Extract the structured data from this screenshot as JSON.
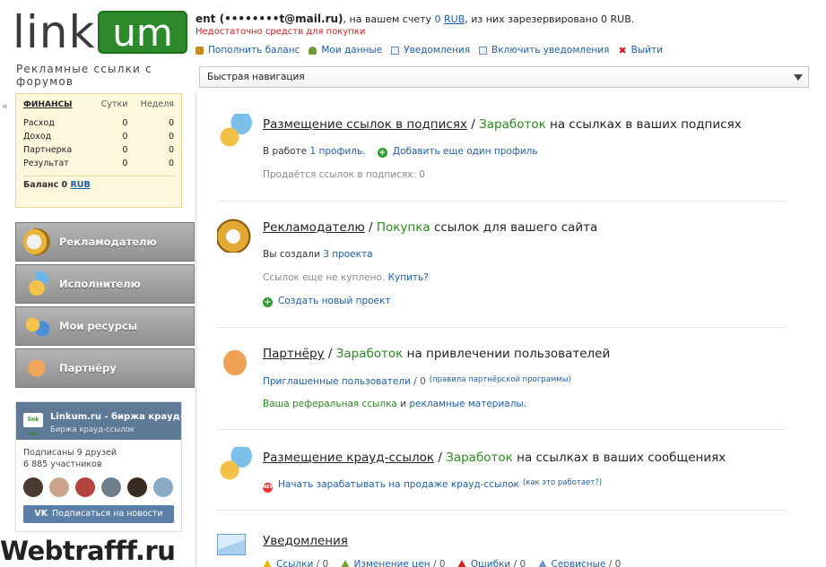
{
  "logo": {
    "word1": "link",
    "word2": "um",
    "tagline": "Рекламные ссылки с форумов"
  },
  "header": {
    "email": "ent (••••••••t@mail.ru)",
    "balance_prefix": ", на вашем счету ",
    "balance_amount": "0",
    "balance_currency": "RUB",
    "reserved_text": ", из них зарезервировано 0 RUB.",
    "insufficient": "Недостаточно средств для покупки",
    "menu": [
      {
        "label": "Пополнить баланс",
        "icon": "wallet-icon"
      },
      {
        "label": "Мои данные",
        "icon": "user-icon"
      },
      {
        "label": "Уведомления",
        "icon": "mail-icon"
      },
      {
        "label": "Включить уведомления",
        "icon": "mail-icon"
      },
      {
        "label": "Выйти",
        "icon": "close-icon"
      }
    ]
  },
  "quicknav": {
    "label": "Быстрая навигация"
  },
  "sidebar": {
    "collapse": "«",
    "finance": {
      "headers": [
        "ФИНАНСЫ",
        "Сутки",
        "Неделя"
      ],
      "rows": [
        [
          "Расход",
          "0",
          "0"
        ],
        [
          "Доход",
          "0",
          "0"
        ],
        [
          "Партнерка",
          "0",
          "0"
        ],
        [
          "Результат",
          "0",
          "0"
        ]
      ],
      "balance_label": "Баланс 0",
      "balance_currency": "RUB"
    },
    "buttons": [
      {
        "label": "Рекламодателю",
        "icon": "megaphone-icon"
      },
      {
        "label": "Исполнителю",
        "icon": "chat-person-icon"
      },
      {
        "label": "Мои ресурсы",
        "icon": "people-icon"
      },
      {
        "label": "Партнёру",
        "icon": "handshake-icon"
      }
    ],
    "vk": {
      "logo_text": "link um",
      "group_name": "Linkum.ru - биржа крауд-сс...",
      "group_sub": "Биржа крауд-ссылок",
      "friends": "Подписаны 9 друзей",
      "members": "6 885 участников",
      "subscribe": "Подписаться на новости"
    }
  },
  "watermark": "Webtrafff.ru",
  "sections": {
    "signatures": {
      "title_link": "Размещение ссылок в подписях",
      "sep": " / ",
      "title_green": "Заработок",
      "title_rest": " на ссылках в ваших подписях",
      "line1_prefix": "В работе ",
      "line1_link": "1 профиль",
      "line1_suffix": ".",
      "add_profile": "Добавить еще один профиль",
      "sold": "Продаётся ссылок в подписях: 0"
    },
    "advertiser": {
      "title_link": "Рекламодателю",
      "sep": " / ",
      "title_green": "Покупка",
      "title_rest": " ссылок для вашего сайта",
      "created_prefix": "Вы создали ",
      "created_link": "3 проекта",
      "not_bought_prefix": "Ссылок еще не куплено. ",
      "buy_link": "Купить?",
      "create_project": "Создать новый проект"
    },
    "partner": {
      "title_link": "Партнёру",
      "sep": " / ",
      "title_green": "Заработок",
      "title_rest": " на привлечении пользователей",
      "invited_link": "Приглашенные пользователи",
      "invited_count": " / 0",
      "rules": "(правила партнёрской программы)",
      "ref_link": "Ваша реферальная ссылка",
      "and": " и ",
      "materials": "рекламные материалы",
      "dot": "."
    },
    "crowd": {
      "title_link": "Размещение крауд-ссылок",
      "sep": " / ",
      "title_green": "Заработок",
      "title_rest": " на ссылках в ваших сообщениях",
      "new_badge": "NEW",
      "start": "Начать зарабатывать на продаже крауд-ссылок",
      "how": "(как это работает?)"
    },
    "notifications": {
      "title_link": "Уведомления",
      "items": [
        {
          "label": "Ссылки",
          "count": " / 0"
        },
        {
          "label": "Изменение цен",
          "count": " / 0"
        },
        {
          "label": "Ошибки",
          "count": " / 0"
        },
        {
          "label": "Сервисные",
          "count": " / 0"
        }
      ]
    }
  }
}
